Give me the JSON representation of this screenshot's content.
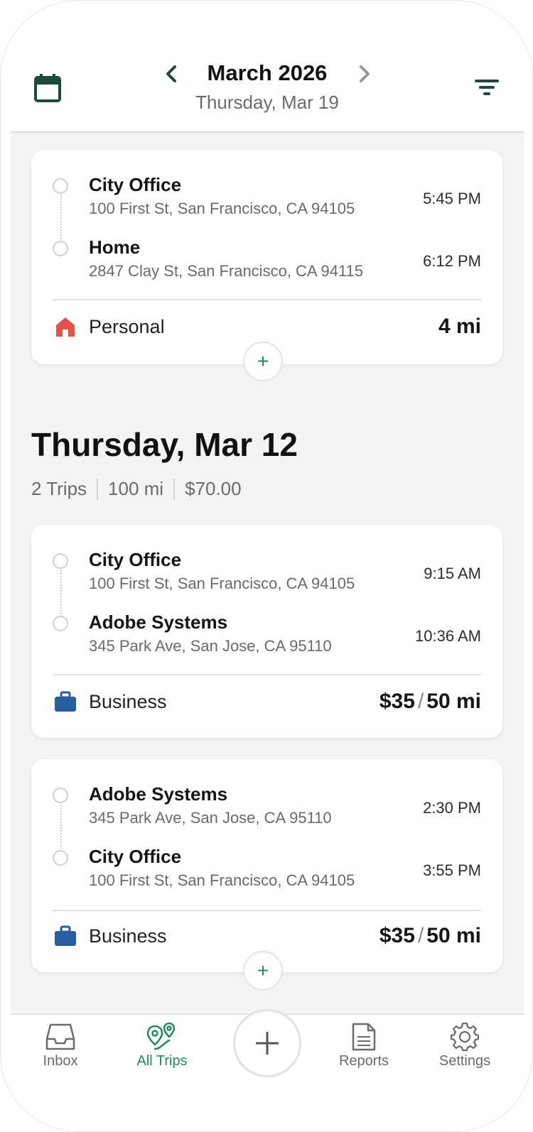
{
  "header": {
    "month": "March 2026",
    "selected_date": "Thursday, Mar 19"
  },
  "trips_top": [
    {
      "stops": [
        {
          "name": "City Office",
          "address": "100 First St, San Francisco, CA 94105",
          "time": "5:45 PM"
        },
        {
          "name": "Home",
          "address": "2847 Clay St, San Francisco, CA 94115",
          "time": "6:12 PM"
        }
      ],
      "category": "Personal",
      "amount": "",
      "distance": "4 mi"
    }
  ],
  "day_section": {
    "title": "Thursday, Mar 12",
    "trips_count": "2 Trips",
    "distance_total": "100 mi",
    "amount_total": "$70.00"
  },
  "trips_day": [
    {
      "stops": [
        {
          "name": "City Office",
          "address": "100 First St, San Francisco, CA 94105",
          "time": "9:15 AM"
        },
        {
          "name": "Adobe Systems",
          "address": "345 Park Ave, San Jose, CA 95110",
          "time": "10:36 AM"
        }
      ],
      "category": "Business",
      "amount": "$35",
      "separator": "/",
      "distance": "50 mi"
    },
    {
      "stops": [
        {
          "name": "Adobe Systems",
          "address": "345 Park Ave, San Jose, CA 95110",
          "time": "2:30 PM"
        },
        {
          "name": "City Office",
          "address": "100 First St, San Francisco, CA 94105",
          "time": "3:55 PM"
        }
      ],
      "category": "Business",
      "amount": "$35",
      "separator": "/",
      "distance": "50 mi"
    }
  ],
  "bottom_nav": {
    "inbox": "Inbox",
    "all_trips": "All Trips",
    "reports": "Reports",
    "settings": "Settings"
  },
  "icons": {
    "calendar": "calendar-icon",
    "prev": "chevron-left-icon",
    "next": "chevron-right-icon",
    "filter": "filter-icon",
    "personal": "home-icon",
    "business": "briefcase-icon",
    "add": "plus-icon"
  },
  "colors": {
    "brand_green": "#1f8a5c",
    "dark_green": "#1e4a3c",
    "personal_red": "#e0524a",
    "business_blue": "#2a5d9f"
  }
}
